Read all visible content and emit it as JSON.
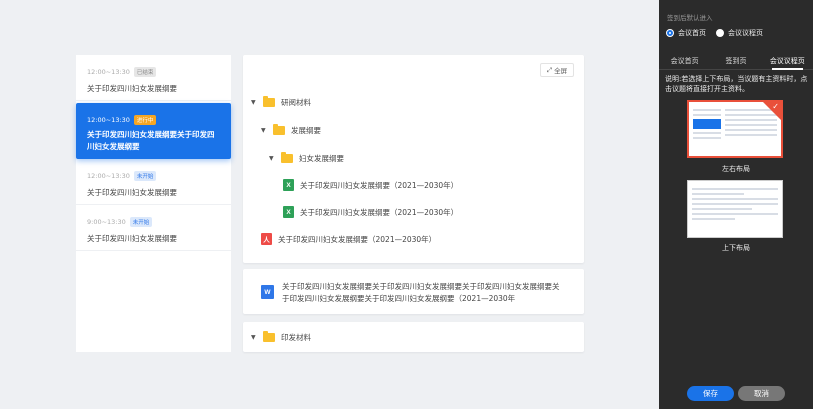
{
  "agenda": {
    "items": [
      {
        "time": "12:00~13:30",
        "status": "已结束",
        "title": "关于印发四川妇女发展纲要"
      },
      {
        "time": "12:00~13:30",
        "status": "进行中",
        "title": "关于印发四川妇女发展纲要关于印发四川妇女发展纲要"
      },
      {
        "time": "12:00~13:30",
        "status": "未开始",
        "title": "关于印发四川妇女发展纲要"
      },
      {
        "time": "9:00~13:30",
        "status": "未开始",
        "title": "关于印发四川妇女发展纲要"
      }
    ]
  },
  "materials": {
    "fullscreen_label": "全屏",
    "tree": {
      "folder1": "研阅材料",
      "folder2": "发展纲要",
      "folder3": "妇女发展纲要",
      "excel1": "关于印发四川妇女发展纲要（2021—2030年）",
      "excel2": "关于印发四川妇女发展纲要（2021—2030年）",
      "pdf1": "关于印发四川妇女发展纲要（2021—2030年）"
    },
    "doc_title": "关于印发四川妇女发展纲要关于印发四川妇女发展纲要关于印发四川妇女发展纲要关于印发四川妇女发展纲要关于印发四川妇女发展纲要（2021—2030年",
    "folder_bottom": "印发材料",
    "icons": {
      "excel": "X",
      "pdf": "人",
      "word": "W"
    }
  },
  "settings": {
    "default_label": "签到后默认进入",
    "radio1": "会议首页",
    "radio2": "会议议程页",
    "tabs": [
      "会议首页",
      "签到页",
      "会议议程页"
    ],
    "desc": "说明:若选择上下布局，当议题有主资料时，点击议题将直接打开主资料。",
    "layout1": "左右布局",
    "layout2": "上下布局",
    "save": "保存",
    "cancel": "取消"
  },
  "colors": {
    "accent": "#1a73e8",
    "ongoing": "#f5a623",
    "folder": "#f9c02d",
    "excel": "#2ea158",
    "pdf": "#ee4b47"
  }
}
